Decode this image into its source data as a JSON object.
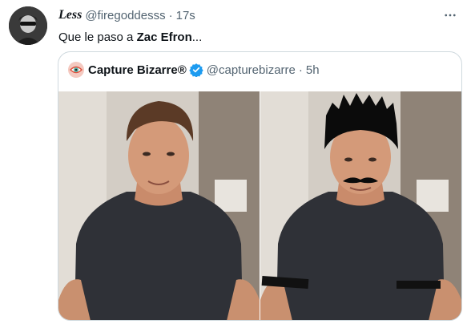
{
  "tweet": {
    "display_name": "Less",
    "handle": "@firegoddesss",
    "separator": "·",
    "time": "17s",
    "text_before": "Que le paso a ",
    "text_bold": "Zac Efron",
    "text_after": "..."
  },
  "quoted": {
    "display_name": "Capture Bizarre®",
    "handle": "@capturebizarre",
    "separator": "·",
    "time": "5h"
  },
  "colors": {
    "text_primary": "#0f1419",
    "text_secondary": "#536471",
    "verified": "#1d9bf0",
    "border": "#cfd9de"
  },
  "icons": {
    "more": "more-horizontal-icon",
    "verified": "verified-badge-icon",
    "logo": "eye-logo-icon"
  }
}
